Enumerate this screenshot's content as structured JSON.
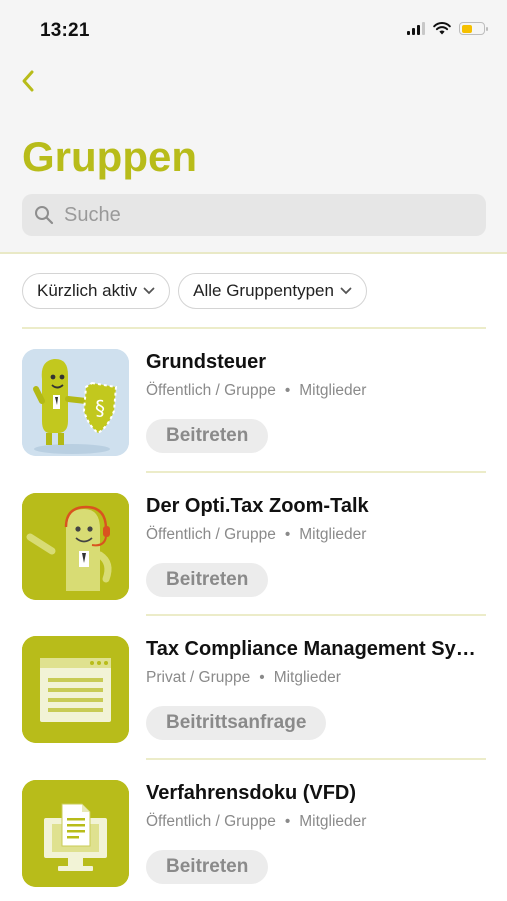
{
  "status_bar": {
    "time": "13:21",
    "battery_color": "#f5c000"
  },
  "nav": {
    "back_icon": "chevron-left-icon"
  },
  "page": {
    "title": "Gruppen",
    "accent_color": "#b8bc1a"
  },
  "search": {
    "placeholder": "Suche"
  },
  "filters": [
    {
      "label": "Kürzlich aktiv"
    },
    {
      "label": "Alle Gruppentypen"
    }
  ],
  "groups": [
    {
      "name": "Grundsteuer",
      "visibility": "Öffentlich / Gruppe",
      "members": "Mitglieder",
      "action": "Beitreten",
      "image": "mascot-shield-illustration"
    },
    {
      "name": "Der Opti.Tax Zoom-Talk",
      "visibility": "Öffentlich / Gruppe",
      "members": "Mitglieder",
      "action": "Beitreten",
      "image": "mascot-headset-illustration"
    },
    {
      "name": "Tax Compliance Management Sy…",
      "visibility": "Privat / Gruppe",
      "members": "Mitglieder",
      "action": "Beitrittsanfrage",
      "image": "browser-window-icon"
    },
    {
      "name": "Verfahrensdoku (VFD)",
      "visibility": "Öffentlich / Gruppe",
      "members": "Mitglieder",
      "action": "Beitreten",
      "image": "monitor-document-icon"
    }
  ]
}
